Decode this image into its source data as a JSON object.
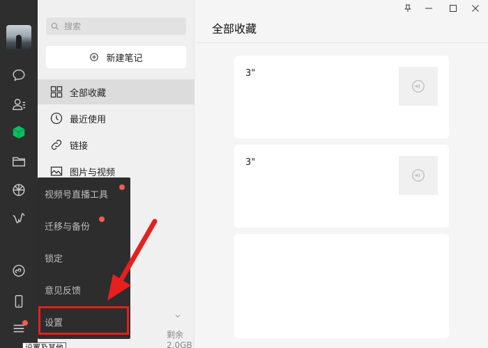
{
  "search": {
    "placeholder": "搜索"
  },
  "new_note": {
    "label": "新建笔记"
  },
  "nav": [
    {
      "label": "全部收藏",
      "icon": "grid-icon",
      "active": true
    },
    {
      "label": "最近使用",
      "icon": "clock-icon"
    },
    {
      "label": "链接",
      "icon": "link-icon"
    },
    {
      "label": "图片与视频",
      "icon": "image-icon"
    }
  ],
  "storage": {
    "remaining": "剩余2.0GB"
  },
  "popup_menu": [
    {
      "label": "视频号直播工具",
      "badge": true
    },
    {
      "label": "迁移与备份",
      "badge": true
    },
    {
      "label": "锁定"
    },
    {
      "label": "意见反馈"
    },
    {
      "label": "设置"
    }
  ],
  "tooltip": {
    "text": "设置及其他"
  },
  "content": {
    "title": "全部收藏",
    "cards": [
      {
        "text": "3\"",
        "thumb_icon": "voice-icon"
      },
      {
        "text": "3\"",
        "thumb_icon": "voice-icon"
      },
      {
        "text": ""
      }
    ]
  },
  "colors": {
    "accent": "#07c160",
    "badge": "#f25c54",
    "highlight": "#e61f1f",
    "rail": "#2e2e2e"
  }
}
